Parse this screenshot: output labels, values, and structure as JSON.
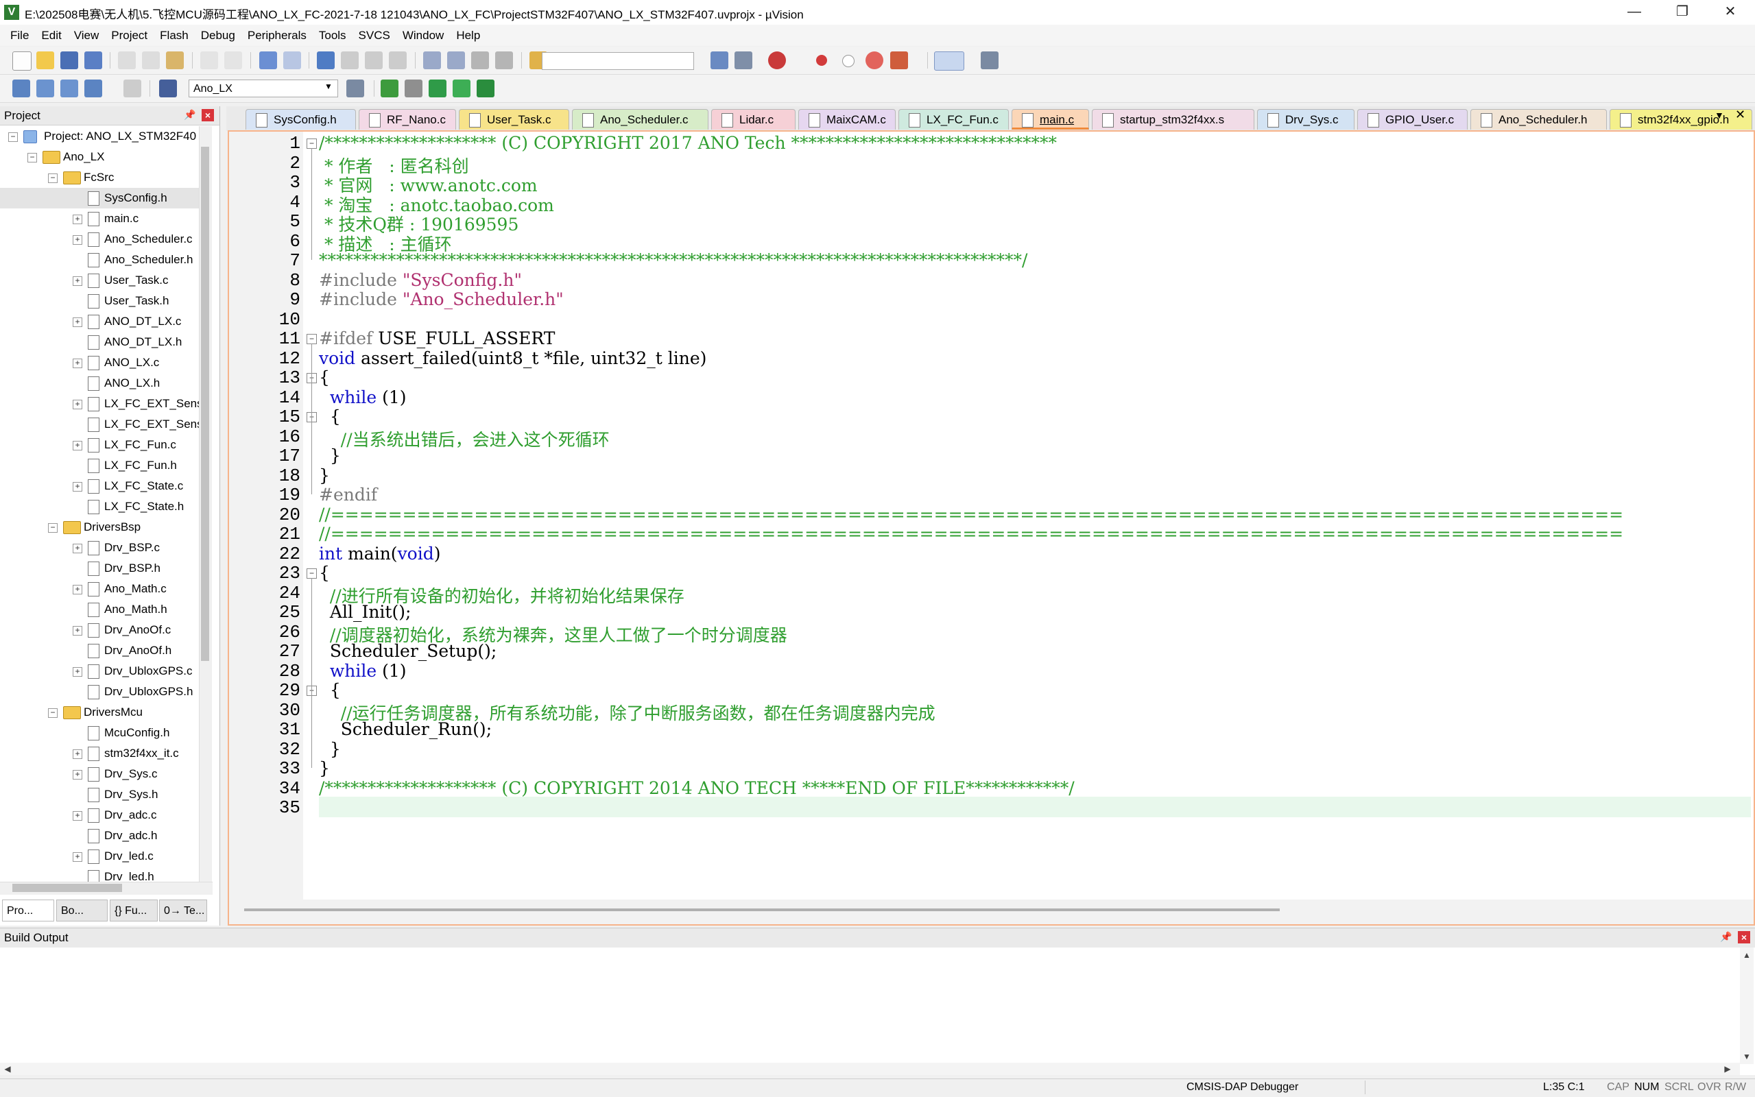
{
  "window": {
    "title": "E:\\202508电赛\\无人机\\5.飞控MCU源码工程\\ANO_LX_FC-2021-7-18 121043\\ANO_LX_FC\\ProjectSTM32F407\\ANO_LX_STM32F407.uvprojx - µVision",
    "app_icon_letter": "V",
    "minimize": "—",
    "maximize": "❐",
    "close": "✕"
  },
  "menu": [
    "File",
    "Edit",
    "View",
    "Project",
    "Flash",
    "Debug",
    "Peripherals",
    "Tools",
    "SVCS",
    "Window",
    "Help"
  ],
  "toolbar2": {
    "target": "Ano_LX"
  },
  "project_panel": {
    "title": "Project",
    "root": "Project: ANO_LX_STM32F40",
    "group": "Ano_LX",
    "folders": [
      {
        "name": "FcSrc",
        "files": [
          {
            "name": "SysConfig.h",
            "expand": false
          },
          {
            "name": "main.c",
            "expand": true
          },
          {
            "name": "Ano_Scheduler.c",
            "expand": true
          },
          {
            "name": "Ano_Scheduler.h",
            "expand": false
          },
          {
            "name": "User_Task.c",
            "expand": true
          },
          {
            "name": "User_Task.h",
            "expand": false
          },
          {
            "name": "ANO_DT_LX.c",
            "expand": true
          },
          {
            "name": "ANO_DT_LX.h",
            "expand": false
          },
          {
            "name": "ANO_LX.c",
            "expand": true
          },
          {
            "name": "ANO_LX.h",
            "expand": false
          },
          {
            "name": "LX_FC_EXT_Sens",
            "expand": true
          },
          {
            "name": "LX_FC_EXT_Sens",
            "expand": false
          },
          {
            "name": "LX_FC_Fun.c",
            "expand": true
          },
          {
            "name": "LX_FC_Fun.h",
            "expand": false
          },
          {
            "name": "LX_FC_State.c",
            "expand": true
          },
          {
            "name": "LX_FC_State.h",
            "expand": false
          }
        ]
      },
      {
        "name": "DriversBsp",
        "files": [
          {
            "name": "Drv_BSP.c",
            "expand": true
          },
          {
            "name": "Drv_BSP.h",
            "expand": false
          },
          {
            "name": "Ano_Math.c",
            "expand": true
          },
          {
            "name": "Ano_Math.h",
            "expand": false
          },
          {
            "name": "Drv_AnoOf.c",
            "expand": true
          },
          {
            "name": "Drv_AnoOf.h",
            "expand": false
          },
          {
            "name": "Drv_UbloxGPS.c",
            "expand": true
          },
          {
            "name": "Drv_UbloxGPS.h",
            "expand": false
          }
        ]
      },
      {
        "name": "DriversMcu",
        "files": [
          {
            "name": "McuConfig.h",
            "expand": false
          },
          {
            "name": "stm32f4xx_it.c",
            "expand": true
          },
          {
            "name": "Drv_Sys.c",
            "expand": true
          },
          {
            "name": "Drv_Sys.h",
            "expand": false
          },
          {
            "name": "Drv_adc.c",
            "expand": true
          },
          {
            "name": "Drv_adc.h",
            "expand": false
          },
          {
            "name": "Drv_led.c",
            "expand": true
          },
          {
            "name": "Drv_led.h",
            "expand": false
          }
        ]
      }
    ],
    "bottom_tabs": [
      "Pro...",
      "Bo...",
      "{} Fu...",
      "0→ Te..."
    ]
  },
  "tabs": [
    {
      "label": "SysConfig.h",
      "color": "#d8e4f5"
    },
    {
      "label": "RF_Nano.c",
      "color": "#f3d9e6"
    },
    {
      "label": "User_Task.c",
      "color": "#f7e38a"
    },
    {
      "label": "Ano_Scheduler.c",
      "color": "#d7ecc8"
    },
    {
      "label": "Lidar.c",
      "color": "#f6d0d6"
    },
    {
      "label": "MaixCAM.c",
      "color": "#e6d7f0"
    },
    {
      "label": "LX_FC_Fun.c",
      "color": "#cfeadf"
    },
    {
      "label": "main.c",
      "color": "#fbd6b7",
      "active": true
    },
    {
      "label": "startup_stm32f4xx.s",
      "color": "#f1dce7"
    },
    {
      "label": "Drv_Sys.c",
      "color": "#d3e3f3"
    },
    {
      "label": "GPIO_User.c",
      "color": "#e3d9ef"
    },
    {
      "label": "Ano_Scheduler.h",
      "color": "#f1e4d5"
    },
    {
      "label": "stm32f4xx_gpio.h",
      "color": "#f4f08b"
    }
  ],
  "code": [
    {
      "n": "1",
      "parts": [
        [
          "c-comment",
          "/******************** (C) COPYRIGHT 2017 ANO Tech *******************************"
        ]
      ]
    },
    {
      "n": "2",
      "parts": [
        [
          "c-comment",
          " * 作者   : 匿名科创"
        ]
      ]
    },
    {
      "n": "3",
      "parts": [
        [
          "c-comment",
          " * 官网   : www.anotc.com"
        ]
      ]
    },
    {
      "n": "4",
      "parts": [
        [
          "c-comment",
          " * 淘宝   : anotc.taobao.com"
        ]
      ]
    },
    {
      "n": "5",
      "parts": [
        [
          "c-comment",
          " * 技术Q群 : 190169595"
        ]
      ]
    },
    {
      "n": "6",
      "parts": [
        [
          "c-comment",
          " * 描述   : 主循环"
        ]
      ]
    },
    {
      "n": "7",
      "parts": [
        [
          "c-comment",
          "**********************************************************************************/"
        ]
      ]
    },
    {
      "n": "8",
      "parts": [
        [
          "c-pp",
          "#include "
        ],
        [
          "c-str",
          "\"SysConfig.h\""
        ]
      ]
    },
    {
      "n": "9",
      "parts": [
        [
          "c-pp",
          "#include "
        ],
        [
          "c-str",
          "\"Ano_Scheduler.h\""
        ]
      ]
    },
    {
      "n": "10",
      "parts": [
        [
          "c-plain",
          ""
        ]
      ]
    },
    {
      "n": "11",
      "parts": [
        [
          "c-pp",
          "#ifdef "
        ],
        [
          "c-plain",
          "USE_FULL_ASSERT"
        ]
      ]
    },
    {
      "n": "12",
      "parts": [
        [
          "c-kw",
          "void "
        ],
        [
          "c-plain",
          "assert_failed(uint8_t *file, uint32_t line)"
        ]
      ]
    },
    {
      "n": "13",
      "parts": [
        [
          "c-plain",
          "{"
        ]
      ]
    },
    {
      "n": "14",
      "parts": [
        [
          "c-plain",
          "  "
        ],
        [
          "c-kw",
          "while"
        ],
        [
          "c-plain",
          " (1)"
        ]
      ]
    },
    {
      "n": "15",
      "parts": [
        [
          "c-plain",
          "  {"
        ]
      ]
    },
    {
      "n": "16",
      "parts": [
        [
          "c-plain",
          "    "
        ],
        [
          "c-comment",
          "//当系统出错后，会进入这个死循环"
        ]
      ]
    },
    {
      "n": "17",
      "parts": [
        [
          "c-plain",
          "  }"
        ]
      ]
    },
    {
      "n": "18",
      "parts": [
        [
          "c-plain",
          "}"
        ]
      ]
    },
    {
      "n": "19",
      "parts": [
        [
          "c-pp",
          "#endif"
        ]
      ]
    },
    {
      "n": "20",
      "parts": [
        [
          "c-comment",
          "//=========================================================================================="
        ]
      ]
    },
    {
      "n": "21",
      "parts": [
        [
          "c-comment",
          "//=========================================================================================="
        ]
      ]
    },
    {
      "n": "22",
      "parts": [
        [
          "c-kw",
          "int "
        ],
        [
          "c-plain",
          "main("
        ],
        [
          "c-kw",
          "void"
        ],
        [
          "c-plain",
          ")"
        ]
      ]
    },
    {
      "n": "23",
      "parts": [
        [
          "c-plain",
          "{"
        ]
      ]
    },
    {
      "n": "24",
      "parts": [
        [
          "c-plain",
          "  "
        ],
        [
          "c-comment",
          "//进行所有设备的初始化，并将初始化结果保存"
        ]
      ]
    },
    {
      "n": "25",
      "parts": [
        [
          "c-plain",
          "  All_Init();"
        ]
      ]
    },
    {
      "n": "26",
      "parts": [
        [
          "c-plain",
          "  "
        ],
        [
          "c-comment",
          "//调度器初始化，系统为裸奔，这里人工做了一个时分调度器"
        ]
      ]
    },
    {
      "n": "27",
      "parts": [
        [
          "c-plain",
          "  Scheduler_Setup();"
        ]
      ]
    },
    {
      "n": "28",
      "parts": [
        [
          "c-plain",
          "  "
        ],
        [
          "c-kw",
          "while"
        ],
        [
          "c-plain",
          " (1)"
        ]
      ]
    },
    {
      "n": "29",
      "parts": [
        [
          "c-plain",
          "  {"
        ]
      ]
    },
    {
      "n": "30",
      "parts": [
        [
          "c-plain",
          "    "
        ],
        [
          "c-comment",
          "//运行任务调度器，所有系统功能，除了中断服务函数，都在任务调度器内完成"
        ]
      ]
    },
    {
      "n": "31",
      "parts": [
        [
          "c-plain",
          "    Scheduler_Run();"
        ]
      ]
    },
    {
      "n": "32",
      "parts": [
        [
          "c-plain",
          "  }"
        ]
      ]
    },
    {
      "n": "33",
      "parts": [
        [
          "c-plain",
          "}"
        ]
      ]
    },
    {
      "n": "34",
      "parts": [
        [
          "c-comment",
          "/******************** (C) COPYRIGHT 2014 ANO TECH *****END OF FILE************/"
        ]
      ]
    },
    {
      "n": "35",
      "parts": [
        [
          "c-plain",
          ""
        ]
      ]
    }
  ],
  "build_output": {
    "title": "Build Output"
  },
  "status": {
    "debugger": "CMSIS-DAP Debugger",
    "position": "L:35 C:1",
    "cap": "CAP",
    "num": "NUM",
    "scrl": "SCRL",
    "ovr": "OVR",
    "rw": "R/W"
  },
  "colors": {
    "editor_border": "#f7b38a",
    "comment": "#2f9e2f",
    "keyword": "#1010c8",
    "string": "#b0306f",
    "current_line": "#e8f8ec"
  }
}
